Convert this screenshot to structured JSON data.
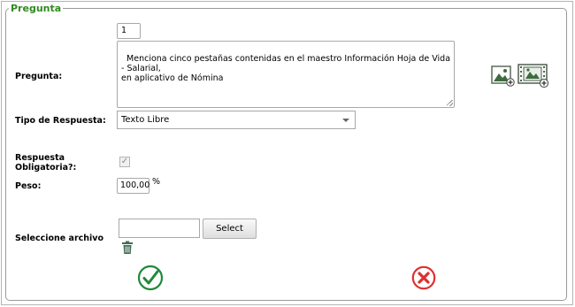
{
  "form": {
    "legend": "Pregunta",
    "labels": {
      "pregunta": "Pregunta:",
      "tipo_respuesta": "Tipo de Respuesta:",
      "respuesta_obligatoria": "Respuesta\nObligatoria?:",
      "peso": "Peso:",
      "seleccione_archivo": "Seleccione archivo"
    },
    "question_number": "1",
    "question_text": "Menciona cinco pestañas contenidas en el maestro Información Hoja de Vida - Salarial,\nen aplicativo de Nómina",
    "tipo_respuesta_selected": "Texto Libre",
    "respuesta_obligatoria_checked": "✓",
    "peso_value": "100,00",
    "peso_unit": "%",
    "file_input_value": "",
    "select_button_label": "Select"
  },
  "icons": {
    "add_image": "add-image-icon",
    "add_video": "add-video-icon",
    "delete": "trash-icon",
    "accept": "check-circle-icon",
    "cancel": "close-circle-icon"
  },
  "colors": {
    "legend": "#2f8a1f",
    "accept": "#1f8a3a",
    "cancel": "#e02f2f"
  }
}
